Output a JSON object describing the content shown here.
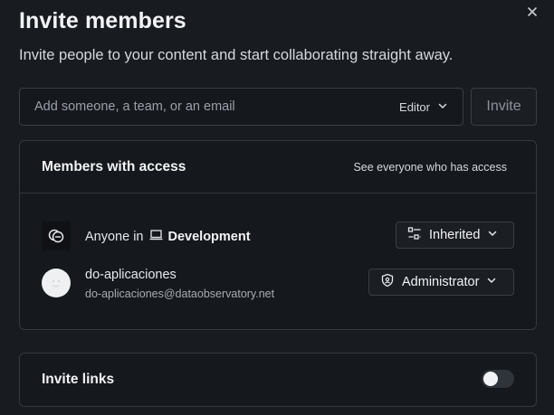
{
  "dialog": {
    "title": "Invite members",
    "subtitle": "Invite people to your content and start collaborating straight away."
  },
  "invite": {
    "placeholder": "Add someone, a team, or an email",
    "role": "Editor",
    "button": "Invite"
  },
  "members": {
    "title": "Members with access",
    "see_all": "See everyone who has access",
    "group": {
      "prefix": "Anyone in",
      "team": "Development",
      "permission": "Inherited"
    },
    "user": {
      "name": "do-aplicaciones",
      "email": "do-aplicaciones@dataobservatory.net",
      "permission": "Administrator"
    }
  },
  "links": {
    "title": "Invite links",
    "enabled": false
  }
}
